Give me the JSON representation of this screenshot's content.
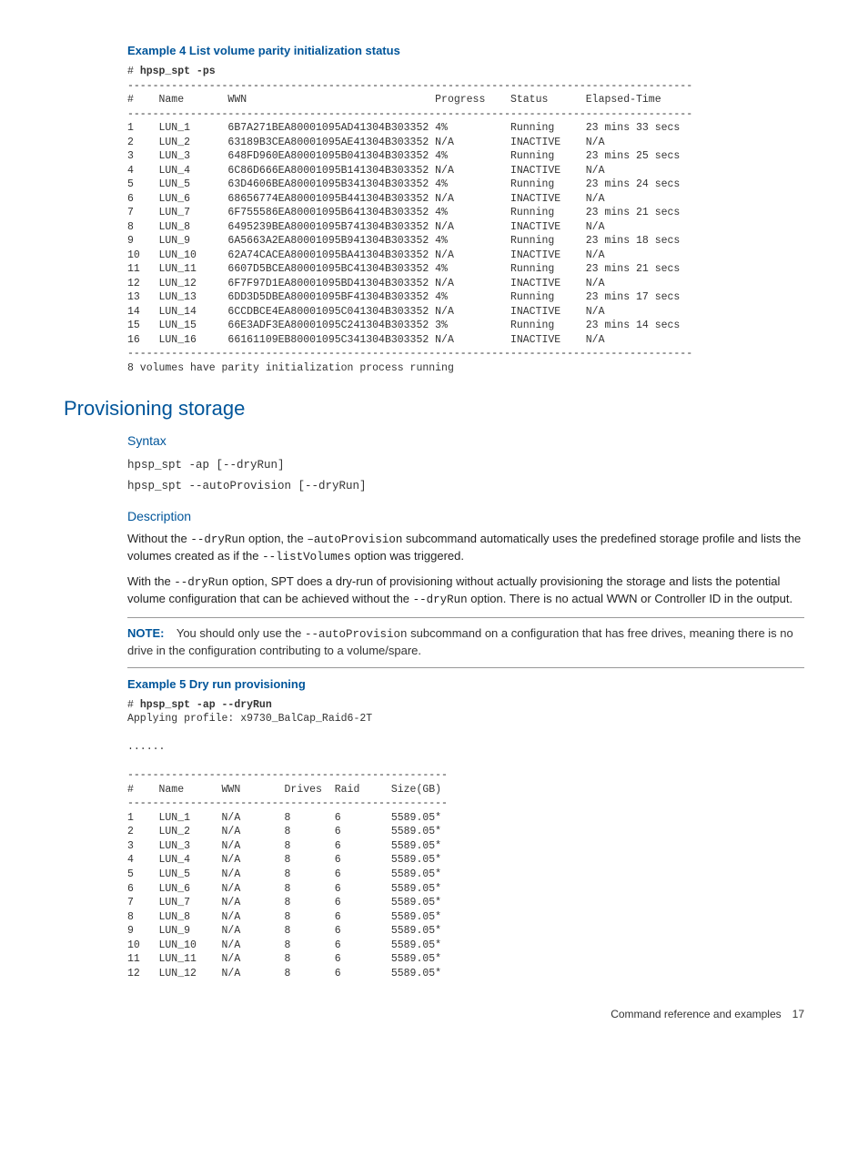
{
  "example4": {
    "title": "Example 4 List volume parity initialization status",
    "command": "hpsp_spt -ps",
    "table": {
      "headers": [
        "#",
        "Name",
        "WWN",
        "Progress",
        "Status",
        "Elapsed-Time"
      ],
      "rows": [
        {
          "n": "1",
          "name": "LUN_1",
          "wwn": "6B7A271BEA80001095AD41304B303352",
          "progress": "4%",
          "status": "Running",
          "elapsed": "23 mins 33 secs"
        },
        {
          "n": "2",
          "name": "LUN_2",
          "wwn": "63189B3CEA80001095AE41304B303352",
          "progress": "N/A",
          "status": "INACTIVE",
          "elapsed": "N/A"
        },
        {
          "n": "3",
          "name": "LUN_3",
          "wwn": "648FD960EA80001095B041304B303352",
          "progress": "4%",
          "status": "Running",
          "elapsed": "23 mins 25 secs"
        },
        {
          "n": "4",
          "name": "LUN_4",
          "wwn": "6C86D666EA80001095B141304B303352",
          "progress": "N/A",
          "status": "INACTIVE",
          "elapsed": "N/A"
        },
        {
          "n": "5",
          "name": "LUN_5",
          "wwn": "63D4606BEA80001095B341304B303352",
          "progress": "4%",
          "status": "Running",
          "elapsed": "23 mins 24 secs"
        },
        {
          "n": "6",
          "name": "LUN_6",
          "wwn": "68656774EA80001095B441304B303352",
          "progress": "N/A",
          "status": "INACTIVE",
          "elapsed": "N/A"
        },
        {
          "n": "7",
          "name": "LUN_7",
          "wwn": "6F755586EA80001095B641304B303352",
          "progress": "4%",
          "status": "Running",
          "elapsed": "23 mins 21 secs"
        },
        {
          "n": "8",
          "name": "LUN_8",
          "wwn": "6495239BEA80001095B741304B303352",
          "progress": "N/A",
          "status": "INACTIVE",
          "elapsed": "N/A"
        },
        {
          "n": "9",
          "name": "LUN_9",
          "wwn": "6A5663A2EA80001095B941304B303352",
          "progress": "4%",
          "status": "Running",
          "elapsed": "23 mins 18 secs"
        },
        {
          "n": "10",
          "name": "LUN_10",
          "wwn": "62A74CACEA80001095BA41304B303352",
          "progress": "N/A",
          "status": "INACTIVE",
          "elapsed": "N/A"
        },
        {
          "n": "11",
          "name": "LUN_11",
          "wwn": "6607D5BCEA80001095BC41304B303352",
          "progress": "4%",
          "status": "Running",
          "elapsed": "23 mins 21 secs"
        },
        {
          "n": "12",
          "name": "LUN_12",
          "wwn": "6F7F97D1EA80001095BD41304B303352",
          "progress": "N/A",
          "status": "INACTIVE",
          "elapsed": "N/A"
        },
        {
          "n": "13",
          "name": "LUN_13",
          "wwn": "6DD3D5DBEA80001095BF41304B303352",
          "progress": "4%",
          "status": "Running",
          "elapsed": "23 mins 17 secs"
        },
        {
          "n": "14",
          "name": "LUN_14",
          "wwn": "6CCDBCE4EA80001095C041304B303352",
          "progress": "N/A",
          "status": "INACTIVE",
          "elapsed": "N/A"
        },
        {
          "n": "15",
          "name": "LUN_15",
          "wwn": "66E3ADF3EA80001095C241304B303352",
          "progress": "3%",
          "status": "Running",
          "elapsed": "23 mins 14 secs"
        },
        {
          "n": "16",
          "name": "LUN_16",
          "wwn": "66161109EB80001095C341304B303352",
          "progress": "N/A",
          "status": "INACTIVE",
          "elapsed": "N/A"
        }
      ],
      "footer": "8 volumes have parity initialization process running"
    }
  },
  "section": {
    "title": "Provisioning storage",
    "syntax": {
      "heading": "Syntax",
      "line1": "hpsp_spt -ap [--dryRun]",
      "line2": "hpsp_spt --autoProvision [--dryRun]"
    },
    "description": {
      "heading": "Description",
      "p1a": "Without the ",
      "p1b": "--dryRun",
      "p1c": " option, the ",
      "p1d": "–autoProvision",
      "p1e": " subcommand automatically uses the predefined storage profile and lists the volumes created as if the ",
      "p1f": "--listVolumes",
      "p1g": " option was triggered.",
      "p2a": "With the ",
      "p2b": "--dryRun",
      "p2c": " option, SPT does a dry-run of provisioning without actually provisioning the storage and lists the potential volume configuration that can be achieved without the ",
      "p2d": " --dryRun",
      "p2e": " option. There is no actual WWN or Controller ID in the output."
    },
    "note": {
      "label": "NOTE:",
      "text1": "You should only use the ",
      "cmd": "--autoProvision",
      "text2": " subcommand on a configuration that has free drives, meaning there is no drive in the configuration contributing to a volume/spare."
    }
  },
  "example5": {
    "title": "Example 5 Dry run provisioning",
    "command": "hpsp_spt -ap --dryRun",
    "apply": "Applying profile: x9730_BalCap_Raid6-2T",
    "dots": "......",
    "table": {
      "headers": [
        "#",
        "Name",
        "WWN",
        "Drives",
        "Raid",
        "Size(GB)"
      ],
      "rows": [
        {
          "n": "1",
          "name": "LUN_1",
          "wwn": "N/A",
          "drives": "8",
          "raid": "6",
          "size": "5589.05*"
        },
        {
          "n": "2",
          "name": "LUN_2",
          "wwn": "N/A",
          "drives": "8",
          "raid": "6",
          "size": "5589.05*"
        },
        {
          "n": "3",
          "name": "LUN_3",
          "wwn": "N/A",
          "drives": "8",
          "raid": "6",
          "size": "5589.05*"
        },
        {
          "n": "4",
          "name": "LUN_4",
          "wwn": "N/A",
          "drives": "8",
          "raid": "6",
          "size": "5589.05*"
        },
        {
          "n": "5",
          "name": "LUN_5",
          "wwn": "N/A",
          "drives": "8",
          "raid": "6",
          "size": "5589.05*"
        },
        {
          "n": "6",
          "name": "LUN_6",
          "wwn": "N/A",
          "drives": "8",
          "raid": "6",
          "size": "5589.05*"
        },
        {
          "n": "7",
          "name": "LUN_7",
          "wwn": "N/A",
          "drives": "8",
          "raid": "6",
          "size": "5589.05*"
        },
        {
          "n": "8",
          "name": "LUN_8",
          "wwn": "N/A",
          "drives": "8",
          "raid": "6",
          "size": "5589.05*"
        },
        {
          "n": "9",
          "name": "LUN_9",
          "wwn": "N/A",
          "drives": "8",
          "raid": "6",
          "size": "5589.05*"
        },
        {
          "n": "10",
          "name": "LUN_10",
          "wwn": "N/A",
          "drives": "8",
          "raid": "6",
          "size": "5589.05*"
        },
        {
          "n": "11",
          "name": "LUN_11",
          "wwn": "N/A",
          "drives": "8",
          "raid": "6",
          "size": "5589.05*"
        },
        {
          "n": "12",
          "name": "LUN_12",
          "wwn": "N/A",
          "drives": "8",
          "raid": "6",
          "size": "5589.05*"
        }
      ]
    }
  },
  "footer": {
    "text": "Command reference and examples",
    "page": "17"
  }
}
